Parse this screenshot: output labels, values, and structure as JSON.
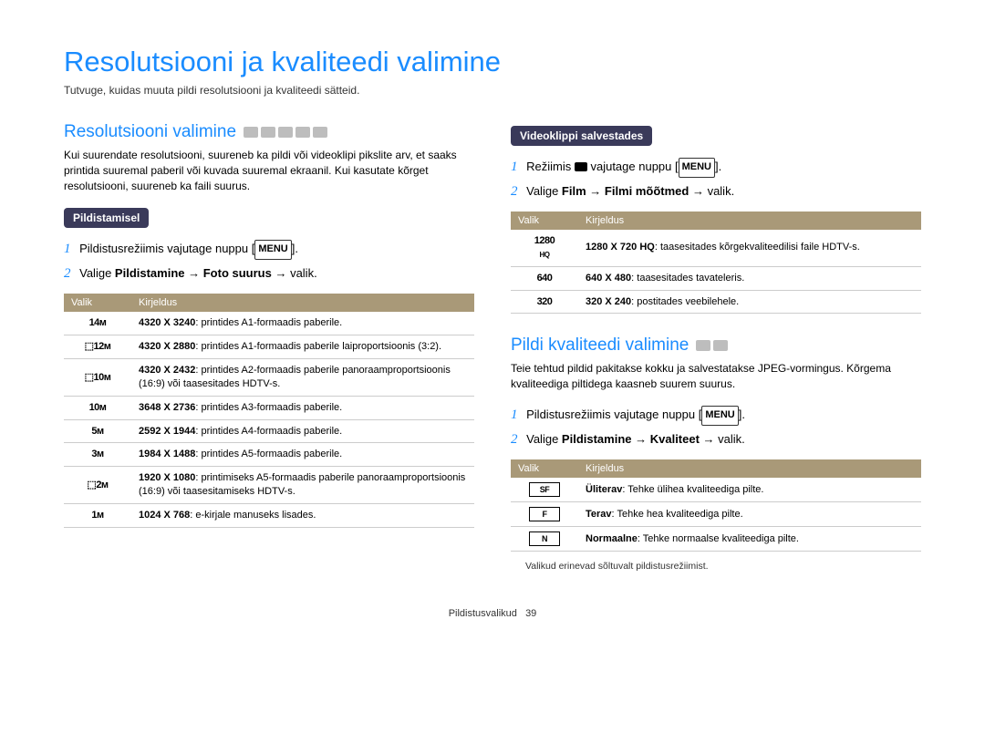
{
  "page": {
    "title": "Resolutsiooni ja kvaliteedi valimine",
    "subtitle": "Tutvuge, kuidas muuta pildi resolutsiooni ja kvaliteedi sätteid.",
    "footer_section": "Pildistusvalikud",
    "footer_page": "39"
  },
  "left": {
    "section_title": "Resolutsiooni valimine",
    "intro": "Kui suurendate resolutsiooni, suureneb ka pildi või videoklipi pikslite arv, et saaks printida suuremal paberil või kuvada suuremal ekraanil. Kui kasutate kõrget resolutsiooni, suureneb ka faili suurus.",
    "subheading": "Pildistamisel",
    "step1_pre": "Pildistusrežiimis vajutage nuppu [",
    "step1_btn": "MENU",
    "step1_post": "].",
    "step2_pre": "Valige ",
    "step2_b1": "Pildistamine",
    "step2_mid": " → ",
    "step2_b2": "Foto suurus",
    "step2_post": " → valik.",
    "table": {
      "h1": "Valik",
      "h2": "Kirjeldus",
      "rows": [
        {
          "icon": "14m",
          "b": "4320 X 3240",
          "t": ": printides A1-formaadis paberile."
        },
        {
          "icon": "12m",
          "b": "4320 X 2880",
          "t": ": printides A1-formaadis paberile laiproportsioonis (3:2)."
        },
        {
          "icon": "10mW",
          "b": "4320 X 2432",
          "t": ": printides A2-formaadis paberile panoraamproportsioonis (16:9) või taasesitades HDTV-s."
        },
        {
          "icon": "10m",
          "b": "3648 X 2736",
          "t": ": printides A3-formaadis paberile."
        },
        {
          "icon": "5m",
          "b": "2592 X 1944",
          "t": ": printides A4-formaadis paberile."
        },
        {
          "icon": "3m",
          "b": "1984 X 1488",
          "t": ": printides A5-formaadis paberile."
        },
        {
          "icon": "2mW",
          "b": "1920 X 1080",
          "t": ": printimiseks A5-formaadis paberile panoraamproportsioonis (16:9) või taasesitamiseks HDTV-s."
        },
        {
          "icon": "1m",
          "b": "1024 X 768",
          "t": ": e-kirjale manuseks lisades."
        }
      ]
    }
  },
  "right": {
    "video_subheading": "Videoklippi salvestades",
    "vstep1_pre": "Režiimis ",
    "vstep1_mid": " vajutage nuppu [",
    "vstep1_btn": "MENU",
    "vstep1_post": "].",
    "vstep2_pre": "Valige ",
    "vstep2_b1": "Film",
    "vstep2_mid1": " → ",
    "vstep2_b2": "Filmi mõõtmed",
    "vstep2_post": " → valik.",
    "vtable": {
      "h1": "Valik",
      "h2": "Kirjeldus",
      "rows": [
        {
          "icon": "1280 HQ",
          "b": "1280 X 720 HQ",
          "t": ": taasesitades kõrgekvaliteedilisi faile HDTV-s."
        },
        {
          "icon": "640",
          "b": "640 X 480",
          "t": ": taasesitades tavateleris."
        },
        {
          "icon": "320",
          "b": "320 X 240",
          "t": ": postitades veebilehele."
        }
      ]
    },
    "quality_title": "Pildi kvaliteedi valimine",
    "quality_intro": "Teie tehtud pildid pakitakse kokku ja salvestatakse JPEG-vormingus. Kõrgema kvaliteediga piltidega kaasneb suurem suurus.",
    "qstep1_pre": "Pildistusrežiimis vajutage nuppu [",
    "qstep1_btn": "MENU",
    "qstep1_post": "].",
    "qstep2_pre": "Valige ",
    "qstep2_b1": "Pildistamine",
    "qstep2_mid": " → ",
    "qstep2_b2": "Kvaliteet",
    "qstep2_post": " → valik.",
    "qtable": {
      "h1": "Valik",
      "h2": "Kirjeldus",
      "rows": [
        {
          "icon": "SF",
          "b": "Üliterav",
          "t": ": Tehke ülihea kvaliteediga pilte."
        },
        {
          "icon": "F",
          "b": "Terav",
          "t": ": Tehke hea kvaliteediga pilte."
        },
        {
          "icon": "N",
          "b": "Normaalne",
          "t": ": Tehke normaalse kvaliteediga pilte."
        }
      ]
    },
    "footnote": "Valikud erinevad sõltuvalt pildistusrežiimist."
  }
}
